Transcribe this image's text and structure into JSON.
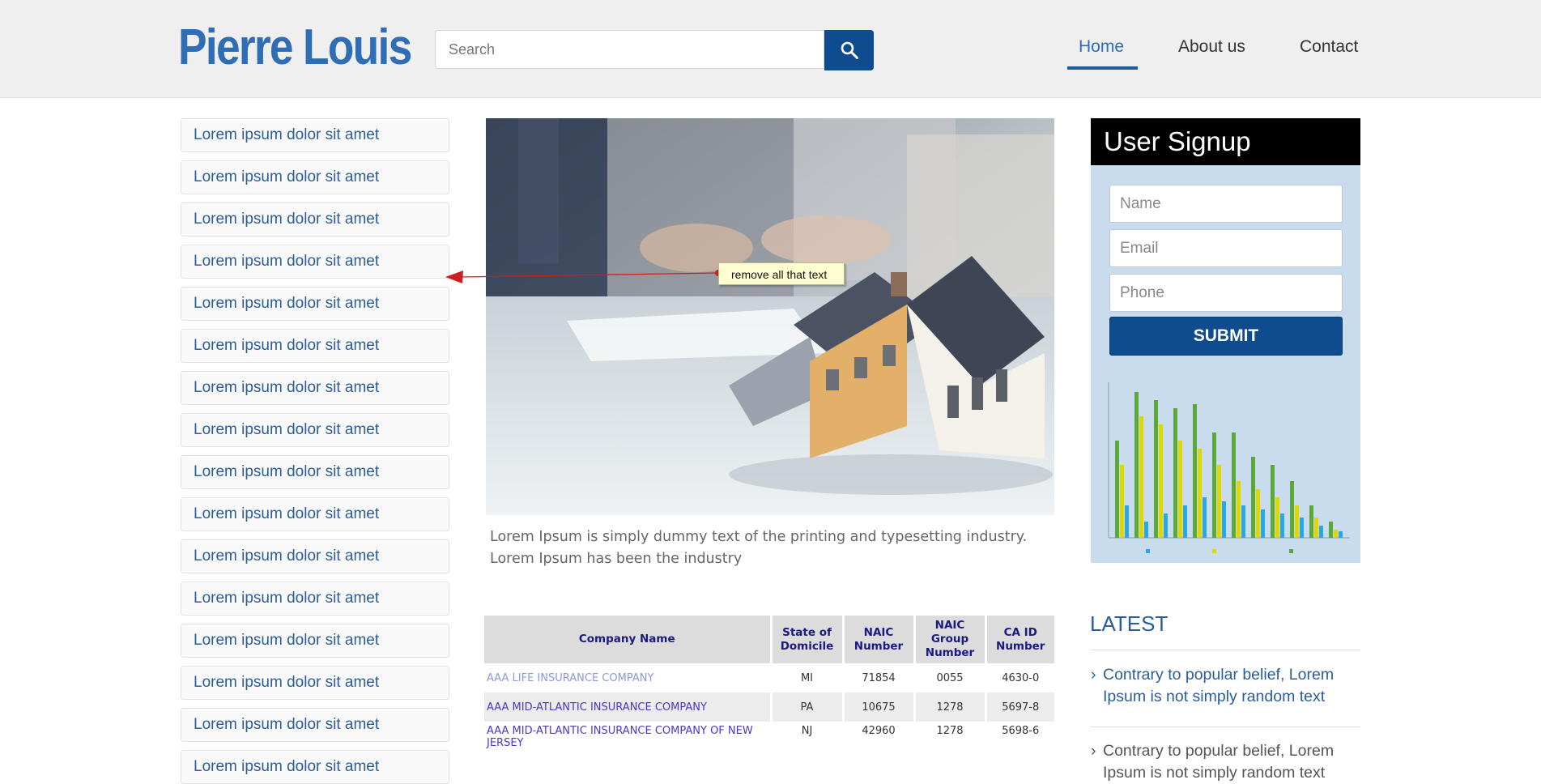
{
  "header": {
    "logo": "Pierre Louis",
    "search": {
      "placeholder": "Search",
      "value": ""
    },
    "nav": [
      {
        "label": "Home",
        "active": true
      },
      {
        "label": "About us",
        "active": false
      },
      {
        "label": "Contact",
        "active": false
      }
    ]
  },
  "sidebar": {
    "items": [
      "Lorem ipsum dolor sit amet",
      "Lorem ipsum dolor sit amet",
      "Lorem ipsum dolor sit amet",
      "Lorem ipsum dolor sit amet",
      "Lorem ipsum dolor sit amet",
      "Lorem ipsum dolor sit amet",
      "Lorem ipsum dolor sit amet",
      "Lorem ipsum dolor sit amet",
      "Lorem ipsum dolor sit amet",
      "Lorem ipsum dolor sit amet",
      "Lorem ipsum dolor sit amet",
      "Lorem ipsum dolor sit amet",
      "Lorem ipsum dolor sit amet",
      "Lorem ipsum dolor sit amet",
      "Lorem ipsum dolor sit amet",
      "Lorem ipsum dolor sit amet"
    ]
  },
  "main": {
    "caption": "Lorem Ipsum is simply dummy text of the printing and typesetting industry. Lorem Ipsum has been the industry",
    "table": {
      "headers": [
        "Company Name",
        "State of Domicile",
        "NAIC Number",
        "NAIC Group Number",
        "CA ID Number"
      ],
      "rows": [
        [
          "AAA LIFE INSURANCE COMPANY",
          "MI",
          "71854",
          "0055",
          "4630-0"
        ],
        [
          "AAA MID-ATLANTIC INSURANCE COMPANY",
          "PA",
          "10675",
          "1278",
          "5697-8"
        ],
        [
          "AAA MID-ATLANTIC INSURANCE COMPANY OF NEW JERSEY",
          "NJ",
          "42960",
          "1278",
          "5698-6"
        ]
      ]
    }
  },
  "signup": {
    "title": "User Signup",
    "name_placeholder": "Name",
    "email_placeholder": "Email",
    "phone_placeholder": "Phone",
    "submit_label": "SUBMIT"
  },
  "latest": {
    "title": "LATEST",
    "items": [
      "Contrary to popular belief, Lorem Ipsum is not simply random text",
      "Contrary to popular belief, Lorem Ipsum is not simply random text"
    ]
  },
  "annotation": {
    "text": "remove all that text",
    "color": "#cc1f1f"
  },
  "colors": {
    "brand": "#2f6db5",
    "button": "#0f4b8f",
    "signup_bg": "#c9dced"
  }
}
